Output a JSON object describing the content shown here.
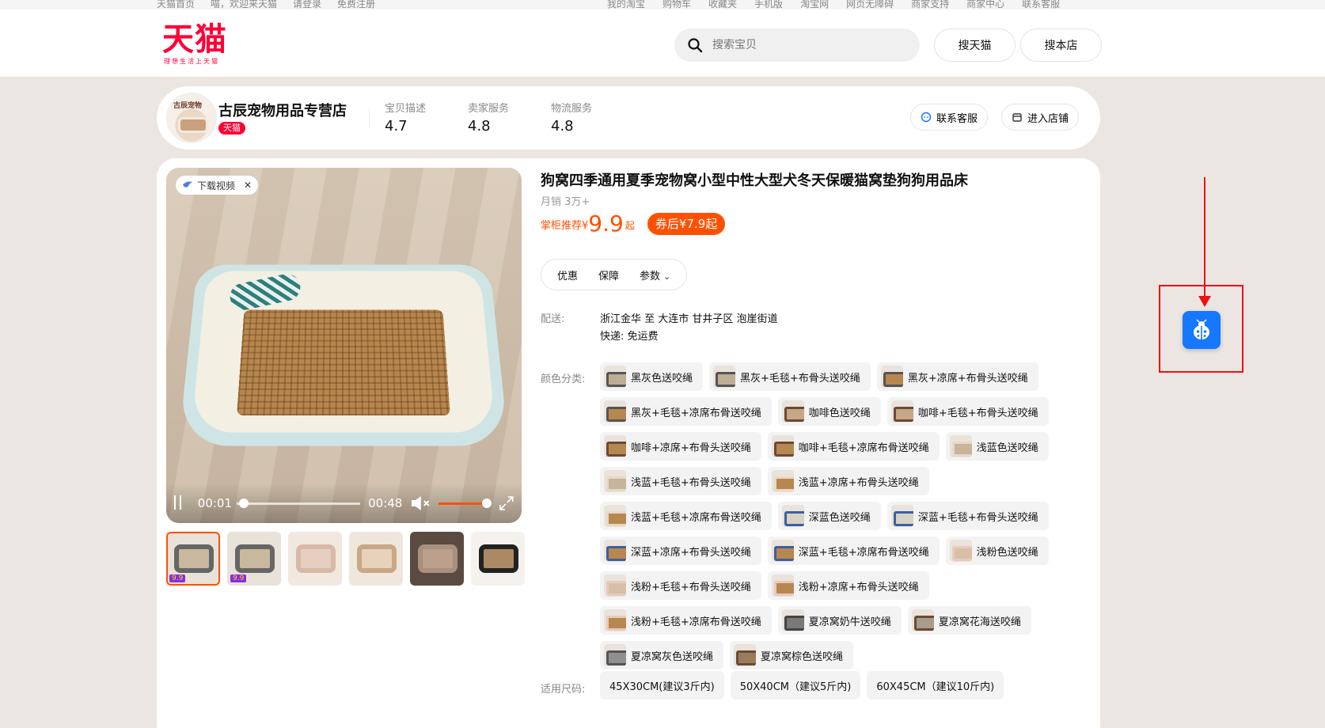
{
  "topbar": {
    "left": [
      "天猫首页",
      "喵，欢迎来天猫",
      "请登录",
      "免费注册"
    ],
    "right": [
      "我的淘宝",
      "购物车",
      "收藏夹",
      "手机版",
      "淘宝网",
      "网页无障碍",
      "商家支持",
      "商家中心",
      "联系客服"
    ]
  },
  "header": {
    "logo": "天猫",
    "logo_sub": "理想生活上天猫",
    "search_placeholder": "搜索宝贝",
    "btn_tmall": "搜天猫",
    "btn_store": "搜本店"
  },
  "shop": {
    "avatar_text": "古辰宠物",
    "name": "古辰宠物用品专营店",
    "badge": "天猫",
    "ratings": [
      {
        "label": "宝贝描述",
        "value": "4.7"
      },
      {
        "label": "卖家服务",
        "value": "4.8"
      },
      {
        "label": "物流服务",
        "value": "4.8"
      }
    ],
    "btn_service": "联系客服",
    "btn_enter": "进入店铺"
  },
  "video": {
    "download_label": "下载视频",
    "time_current": "00:01",
    "time_total": "00:48",
    "progress": 0.02,
    "volume": 1.0
  },
  "thumb_tag": "9.9",
  "product": {
    "title": "狗窝四季通用夏季宠物窝小型中性大型犬冬天保暖猫窝垫狗狗用品床",
    "monthly_sales": "月销 3万+",
    "price_label": "掌柜推荐",
    "price_currency": "¥",
    "price_value": "9.9",
    "price_suffix": "起",
    "coupon": "券后¥7.9起",
    "tabs": [
      "优惠",
      "保障",
      "参数"
    ],
    "shipping_label": "配送:",
    "shipping_route": "浙江金华 至 大连市 甘井子区 泡崖街道",
    "shipping_fee": "快递: 免运费",
    "color_label": "颜色分类:",
    "colors": [
      "黑灰色送咬绳",
      "黑灰+毛毯+布骨头送咬绳",
      "黑灰+凉席+布骨头送咬绳",
      "黑灰+毛毯+凉席布骨送咬绳",
      "咖啡色送咬绳",
      "咖啡+毛毯+布骨头送咬绳",
      "咖啡+凉席+布骨头送咬绳",
      "咖啡+毛毯+凉席布骨送咬绳",
      "浅蓝色送咬绳",
      "浅蓝+毛毯+布骨头送咬绳",
      "浅蓝+凉席+布骨头送咬绳",
      "浅蓝+毛毯+凉席布骨送咬绳",
      "深蓝色送咬绳",
      "深蓝+毛毯+布骨头送咬绳",
      "深蓝+凉席+布骨头送咬绳",
      "深蓝+毛毯+凉席布骨送咬绳",
      "浅粉色送咬绳",
      "浅粉+毛毯+布骨头送咬绳",
      "浅粉+凉席+布骨头送咬绳",
      "浅粉+毛毯+凉席布骨送咬绳",
      "夏凉窝奶牛送咬绳",
      "夏凉窝花海送咬绳",
      "夏凉窝灰色送咬绳",
      "夏凉窝棕色送咬绳"
    ],
    "size_label": "适用尺码:",
    "sizes": [
      "45X30CM(建议3斤内)",
      "50X40CM（建议5斤内)",
      "60X45CM（建议10斤内)"
    ]
  },
  "colors": {
    "brand": "#ff0036",
    "accent": "#ff5000",
    "widget": "#1677ff",
    "highlight": "#ee1111"
  }
}
